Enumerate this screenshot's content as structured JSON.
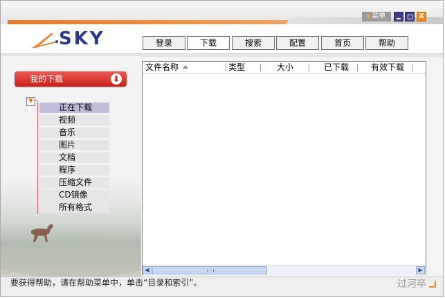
{
  "window": {
    "menu_label": "菜单",
    "controls": {
      "minimize": "minimize",
      "maximize": "maximize",
      "close": "X"
    }
  },
  "brand": {
    "name": "SKY",
    "accent": "#e8792a",
    "brand_blue": "#2c3a8c"
  },
  "nav": {
    "tabs": [
      {
        "label": "登录"
      },
      {
        "label": "下载"
      },
      {
        "label": "搜索"
      },
      {
        "label": "配置"
      },
      {
        "label": "首页"
      },
      {
        "label": "帮助"
      }
    ],
    "active": "下载"
  },
  "sidebar": {
    "my_downloads_label": "我的下载",
    "items": [
      {
        "label": "正在下载"
      },
      {
        "label": "视频"
      },
      {
        "label": "音乐"
      },
      {
        "label": "图片"
      },
      {
        "label": "文档"
      },
      {
        "label": "程序"
      },
      {
        "label": "压缩文件"
      },
      {
        "label": "CD镜像"
      },
      {
        "label": "所有格式"
      }
    ],
    "selected": "正在下载"
  },
  "list": {
    "columns": [
      {
        "label": "文件名称"
      },
      {
        "label": "类型"
      },
      {
        "label": "大小"
      },
      {
        "label": "已下载"
      },
      {
        "label": "有效下载"
      }
    ],
    "rows": []
  },
  "status": {
    "text": "要获得帮助，请在帮助菜单中，单击“目录和索引”。",
    "watermark": "过河卒"
  }
}
